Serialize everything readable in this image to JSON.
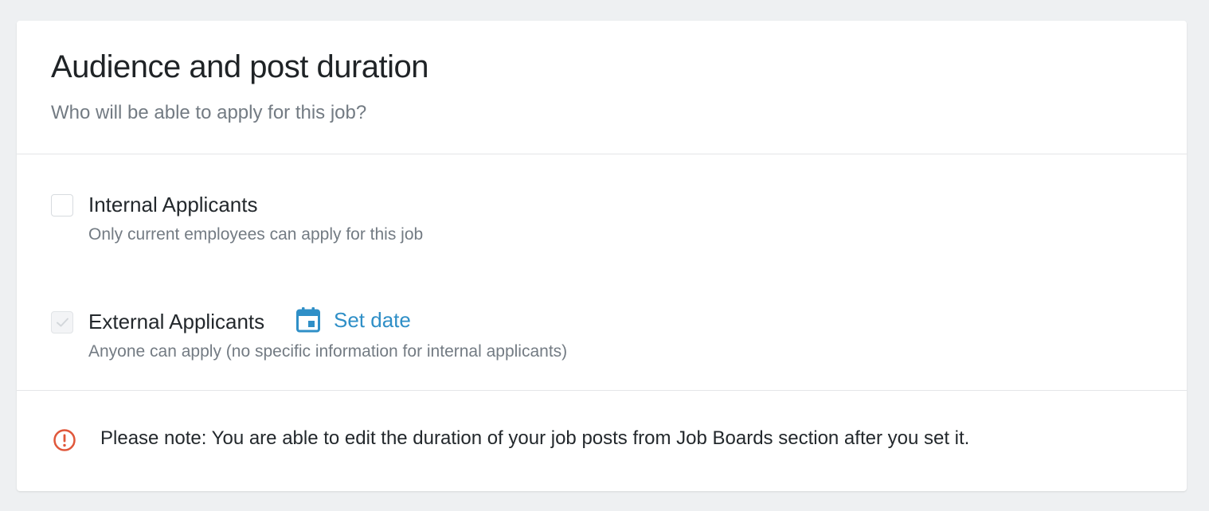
{
  "section": {
    "title": "Audience and post duration",
    "subtitle": "Who will be able to apply for this job?"
  },
  "options": [
    {
      "label": "Internal Applicants",
      "description": "Only current employees can apply for this job",
      "checked": false,
      "disabled": false
    },
    {
      "label": "External Applicants",
      "description": "Anyone can apply (no specific information for internal applicants)",
      "checked": true,
      "disabled": true,
      "action": {
        "icon": "calendar-icon",
        "label": "Set date"
      }
    }
  ],
  "note": {
    "icon": "alert-circle-icon",
    "text": "Please note: You are able to edit the duration of your job posts from Job Boards section after you set it."
  },
  "colors": {
    "page_background": "#eef0f2",
    "card_background": "#ffffff",
    "link": "#2f8fc7",
    "warning": "#e0573a",
    "muted_text": "#737b83"
  }
}
